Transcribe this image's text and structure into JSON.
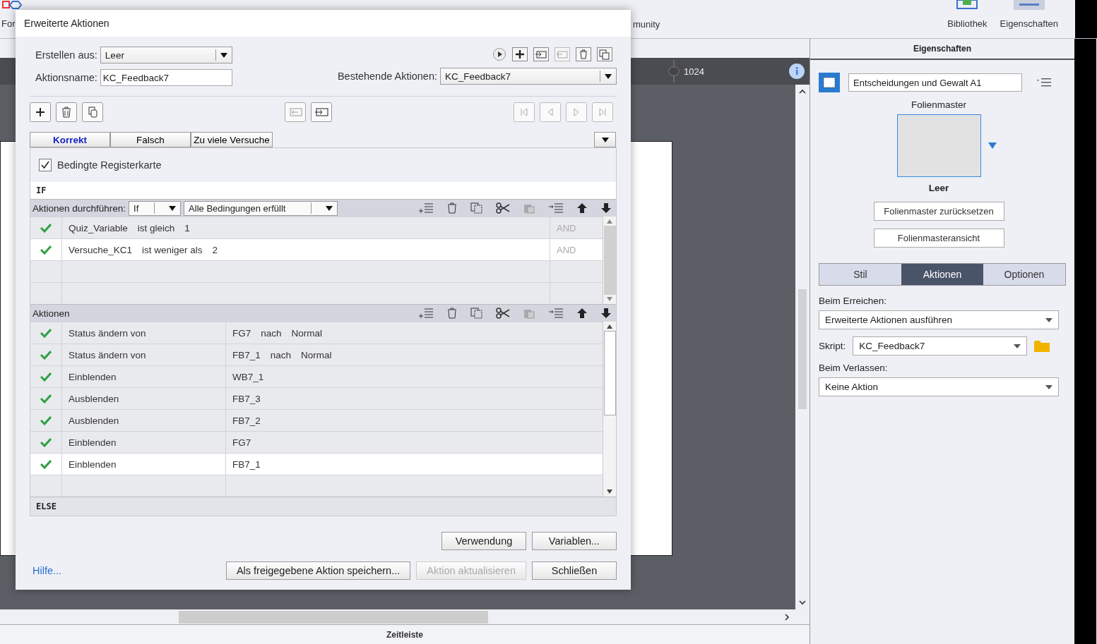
{
  "app": {
    "left_text": "For",
    "right_text": "munity",
    "panel_buttons": [
      {
        "label": "Bibliothek",
        "selected": false
      },
      {
        "label": "Eigenschaften",
        "selected": true
      }
    ]
  },
  "canvas": {
    "ruler_value": "1024"
  },
  "timeline": {
    "title": "Zeitleiste"
  },
  "properties": {
    "header": "Eigenschaften",
    "slide_name": "Entscheidungen und Gewalt A1",
    "master_label": "Folienmaster",
    "master_name": "Leer",
    "buttons": [
      "Folienmaster zurücksetzen",
      "Folienmasteransicht"
    ],
    "tabs": [
      {
        "label": "Stil",
        "selected": false
      },
      {
        "label": "Aktionen",
        "selected": true
      },
      {
        "label": "Optionen",
        "selected": false
      }
    ],
    "fields": [
      {
        "label": "Beim Erreichen:",
        "value": "Erweiterte Aktionen ausführen",
        "kind": "stacked"
      },
      {
        "label": "Skript:",
        "value": "KC_Feedback7",
        "kind": "inline"
      },
      {
        "label": "Beim Verlassen:",
        "value": "Keine Aktion",
        "kind": "stacked"
      }
    ]
  },
  "dialog": {
    "title": "Erweiterte Aktionen",
    "create_from": {
      "label": "Erstellen aus:",
      "value": "Leer"
    },
    "action_name": {
      "label": "Aktionsname:",
      "value": "KC_Feedback7"
    },
    "existing": {
      "label": "Bestehende Aktionen:",
      "value": "KC_Feedback7"
    },
    "tabs": [
      {
        "label": "Korrekt",
        "selected": true
      },
      {
        "label": "Falsch",
        "selected": false
      },
      {
        "label": "Zu viele Versuche",
        "selected": false
      }
    ],
    "conditional": {
      "label": "Bedingte Registerkarte",
      "checked": true
    },
    "if_label": "IF",
    "perform": {
      "label": "Aktionen durchführen:",
      "mode": "If",
      "condition": "Alle Bedingungen erfüllt"
    },
    "conditions": [
      {
        "variable": "Quiz_Variable",
        "operator": "ist gleich",
        "value": "1",
        "join": "AND",
        "selected": false
      },
      {
        "variable": "Versuche_KC1",
        "operator": "ist weniger als",
        "value": "2",
        "join": "AND",
        "selected": true
      }
    ],
    "actions_label": "Aktionen",
    "actions": [
      {
        "action": "Status ändern von",
        "target": "FG7",
        "to": "nach",
        "state": "Normal",
        "selected": false
      },
      {
        "action": "Status ändern von",
        "target": "FB7_1",
        "to": "nach",
        "state": "Normal",
        "selected": false
      },
      {
        "action": "Einblenden",
        "target": "WB7_1",
        "selected": false
      },
      {
        "action": "Ausblenden",
        "target": "FB7_3",
        "selected": false
      },
      {
        "action": "Ausblenden",
        "target": "FB7_2",
        "selected": false
      },
      {
        "action": "Einblenden",
        "target": "FG7",
        "selected": false
      },
      {
        "action": "Einblenden",
        "target": "FB7_1",
        "selected": true
      }
    ],
    "else_label": "ELSE",
    "help": "Hilfe...",
    "upper_buttons": [
      {
        "label": "Verwendung",
        "disabled": false
      },
      {
        "label": "Variablen...",
        "disabled": false
      }
    ],
    "lower_buttons": [
      {
        "label": "Als freigegebene Aktion speichern...",
        "disabled": false
      },
      {
        "label": "Aktion aktualisieren",
        "disabled": true
      },
      {
        "label": "Schließen",
        "disabled": false
      }
    ]
  }
}
